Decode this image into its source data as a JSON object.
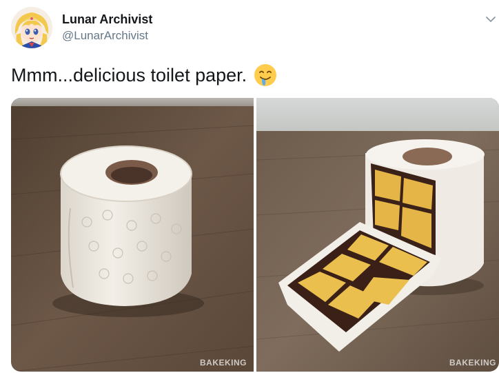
{
  "user": {
    "display_name": "Lunar Archivist",
    "handle": "@LunarArchivist"
  },
  "tweet": {
    "text": "Mmm...delicious toilet paper.",
    "emoji": "drooling-face-icon"
  },
  "media": {
    "left_image": "toilet-paper-roll-cake",
    "right_image": "sliced-toilet-paper-cake",
    "watermark": "BAKEKING"
  },
  "icons": {
    "menu": "chevron-down-icon"
  },
  "colors": {
    "name": "#14171a",
    "handle": "#657786",
    "chevron": "#8899a6"
  }
}
